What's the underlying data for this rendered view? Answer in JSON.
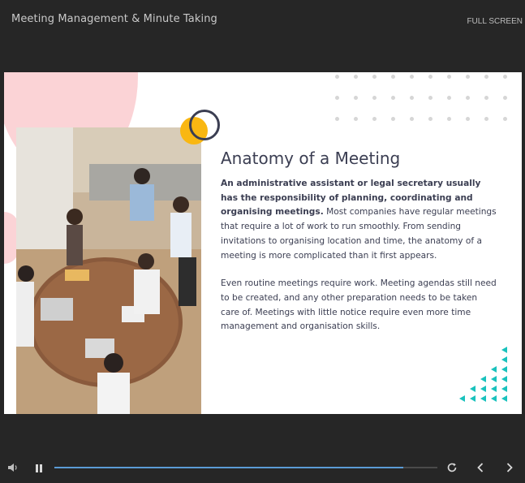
{
  "header": {
    "title": "Meeting Management & Minute Taking",
    "fullscreen_label": "FULL SCREEN"
  },
  "slide": {
    "title": "Anatomy of a Meeting",
    "paragraph1_bold": "An administrative assistant or legal secretary usually has the responsibility of planning, coordinating and organising meetings.",
    "paragraph1_rest": " Most companies have regular meetings that require a lot of work to run smoothly. From sending invitations to organising location and time, the anatomy of a meeting is more complicated than it first appears.",
    "paragraph2": "Even routine meetings require work. Meeting agendas still need to be created, and any other preparation needs to be taken care of. Meetings with little notice require even more time management and organisation skills.",
    "image_icon": "office-meeting-photo"
  },
  "player": {
    "progress": 0.91,
    "icons": {
      "volume": "speaker-icon",
      "pause": "pause-icon",
      "replay": "replay-icon",
      "prev": "chevron-left-icon",
      "next": "chevron-right-icon"
    }
  },
  "colors": {
    "background": "#262626",
    "accent_pink": "#fbd3d6",
    "accent_yellow": "#f9b712",
    "accent_teal": "#19c2bd",
    "text_dark": "#3b3e52",
    "progress_blue": "#5b9bd5"
  }
}
